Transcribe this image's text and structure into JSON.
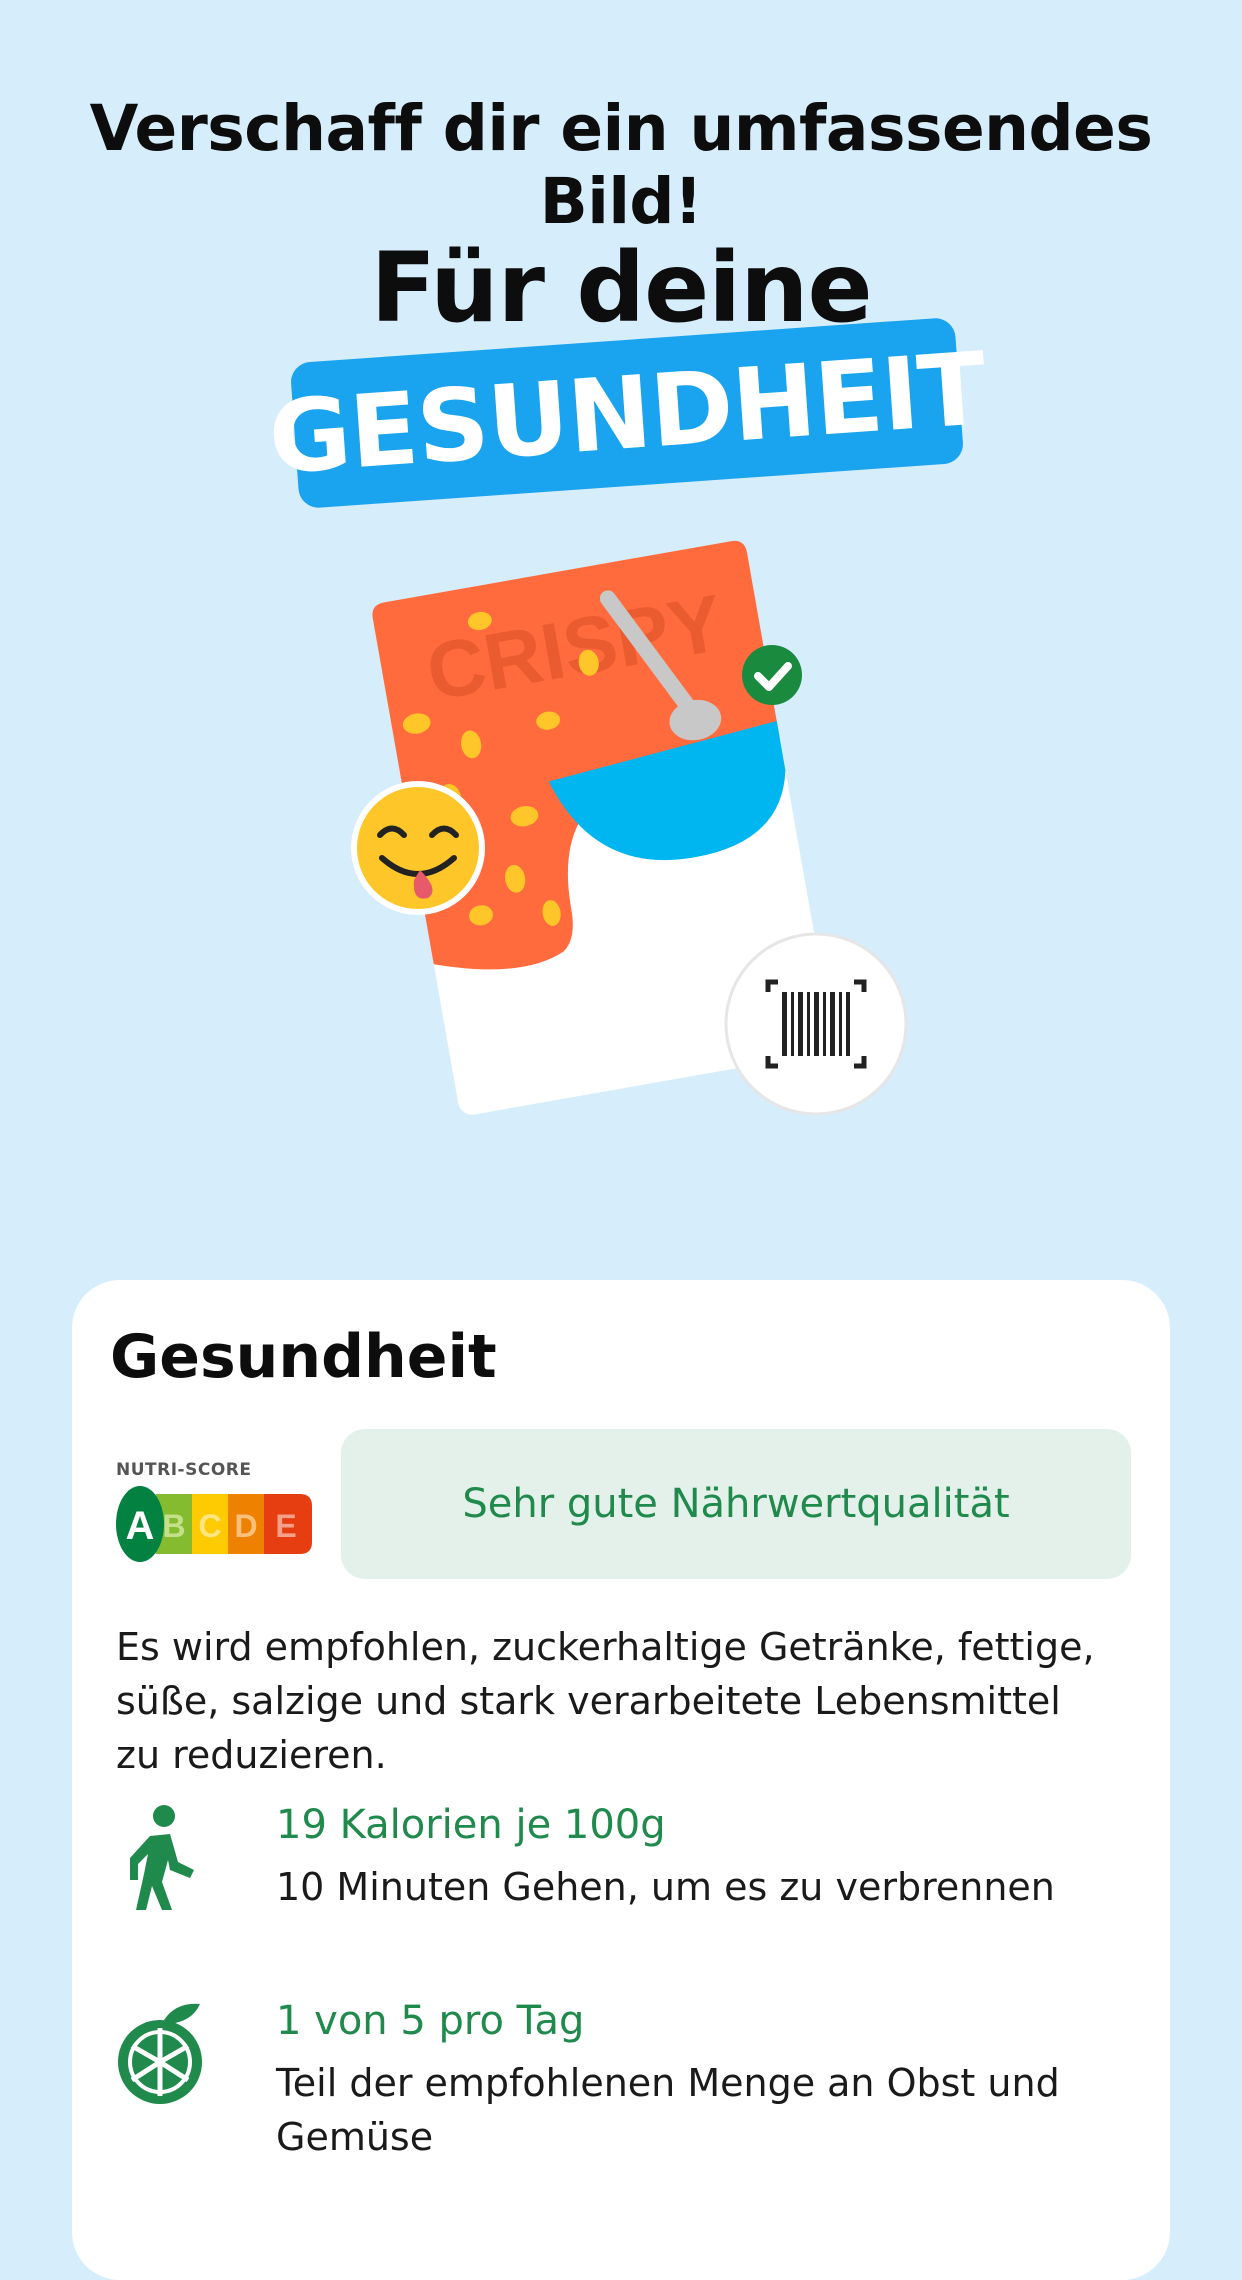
{
  "hero": {
    "headline": "Verschaff dir ein umfassendes Bild!",
    "subheadline": "Für deine",
    "badge": "GESUNDHEIT",
    "package_text": "CRISPY",
    "colors": {
      "badge": "#1aa3ee",
      "background": "#d6edfb",
      "package": "#ff6b3d"
    }
  },
  "card": {
    "title": "Gesundheit",
    "nutri_score": {
      "label": "NUTRI-SCORE",
      "grades": [
        "A",
        "B",
        "C",
        "D",
        "E"
      ],
      "selected": "A"
    },
    "quality_text": "Sehr gute Nährwertqualität",
    "advice": "Es wird empfohlen, zuckerhaltige Getränke, fettige, süße, salzige und stark verarbeitete Lebensmittel zu reduzieren.",
    "facts": [
      {
        "icon": "walking-person-icon",
        "title": "19 Kalorien je 100g",
        "desc": "10 Minuten Gehen, um es zu verbrennen"
      },
      {
        "icon": "fruit-icon",
        "title": "1 von 5 pro Tag",
        "desc": "Teil der empfohlenen Menge an Obst und Gemüse"
      }
    ]
  }
}
